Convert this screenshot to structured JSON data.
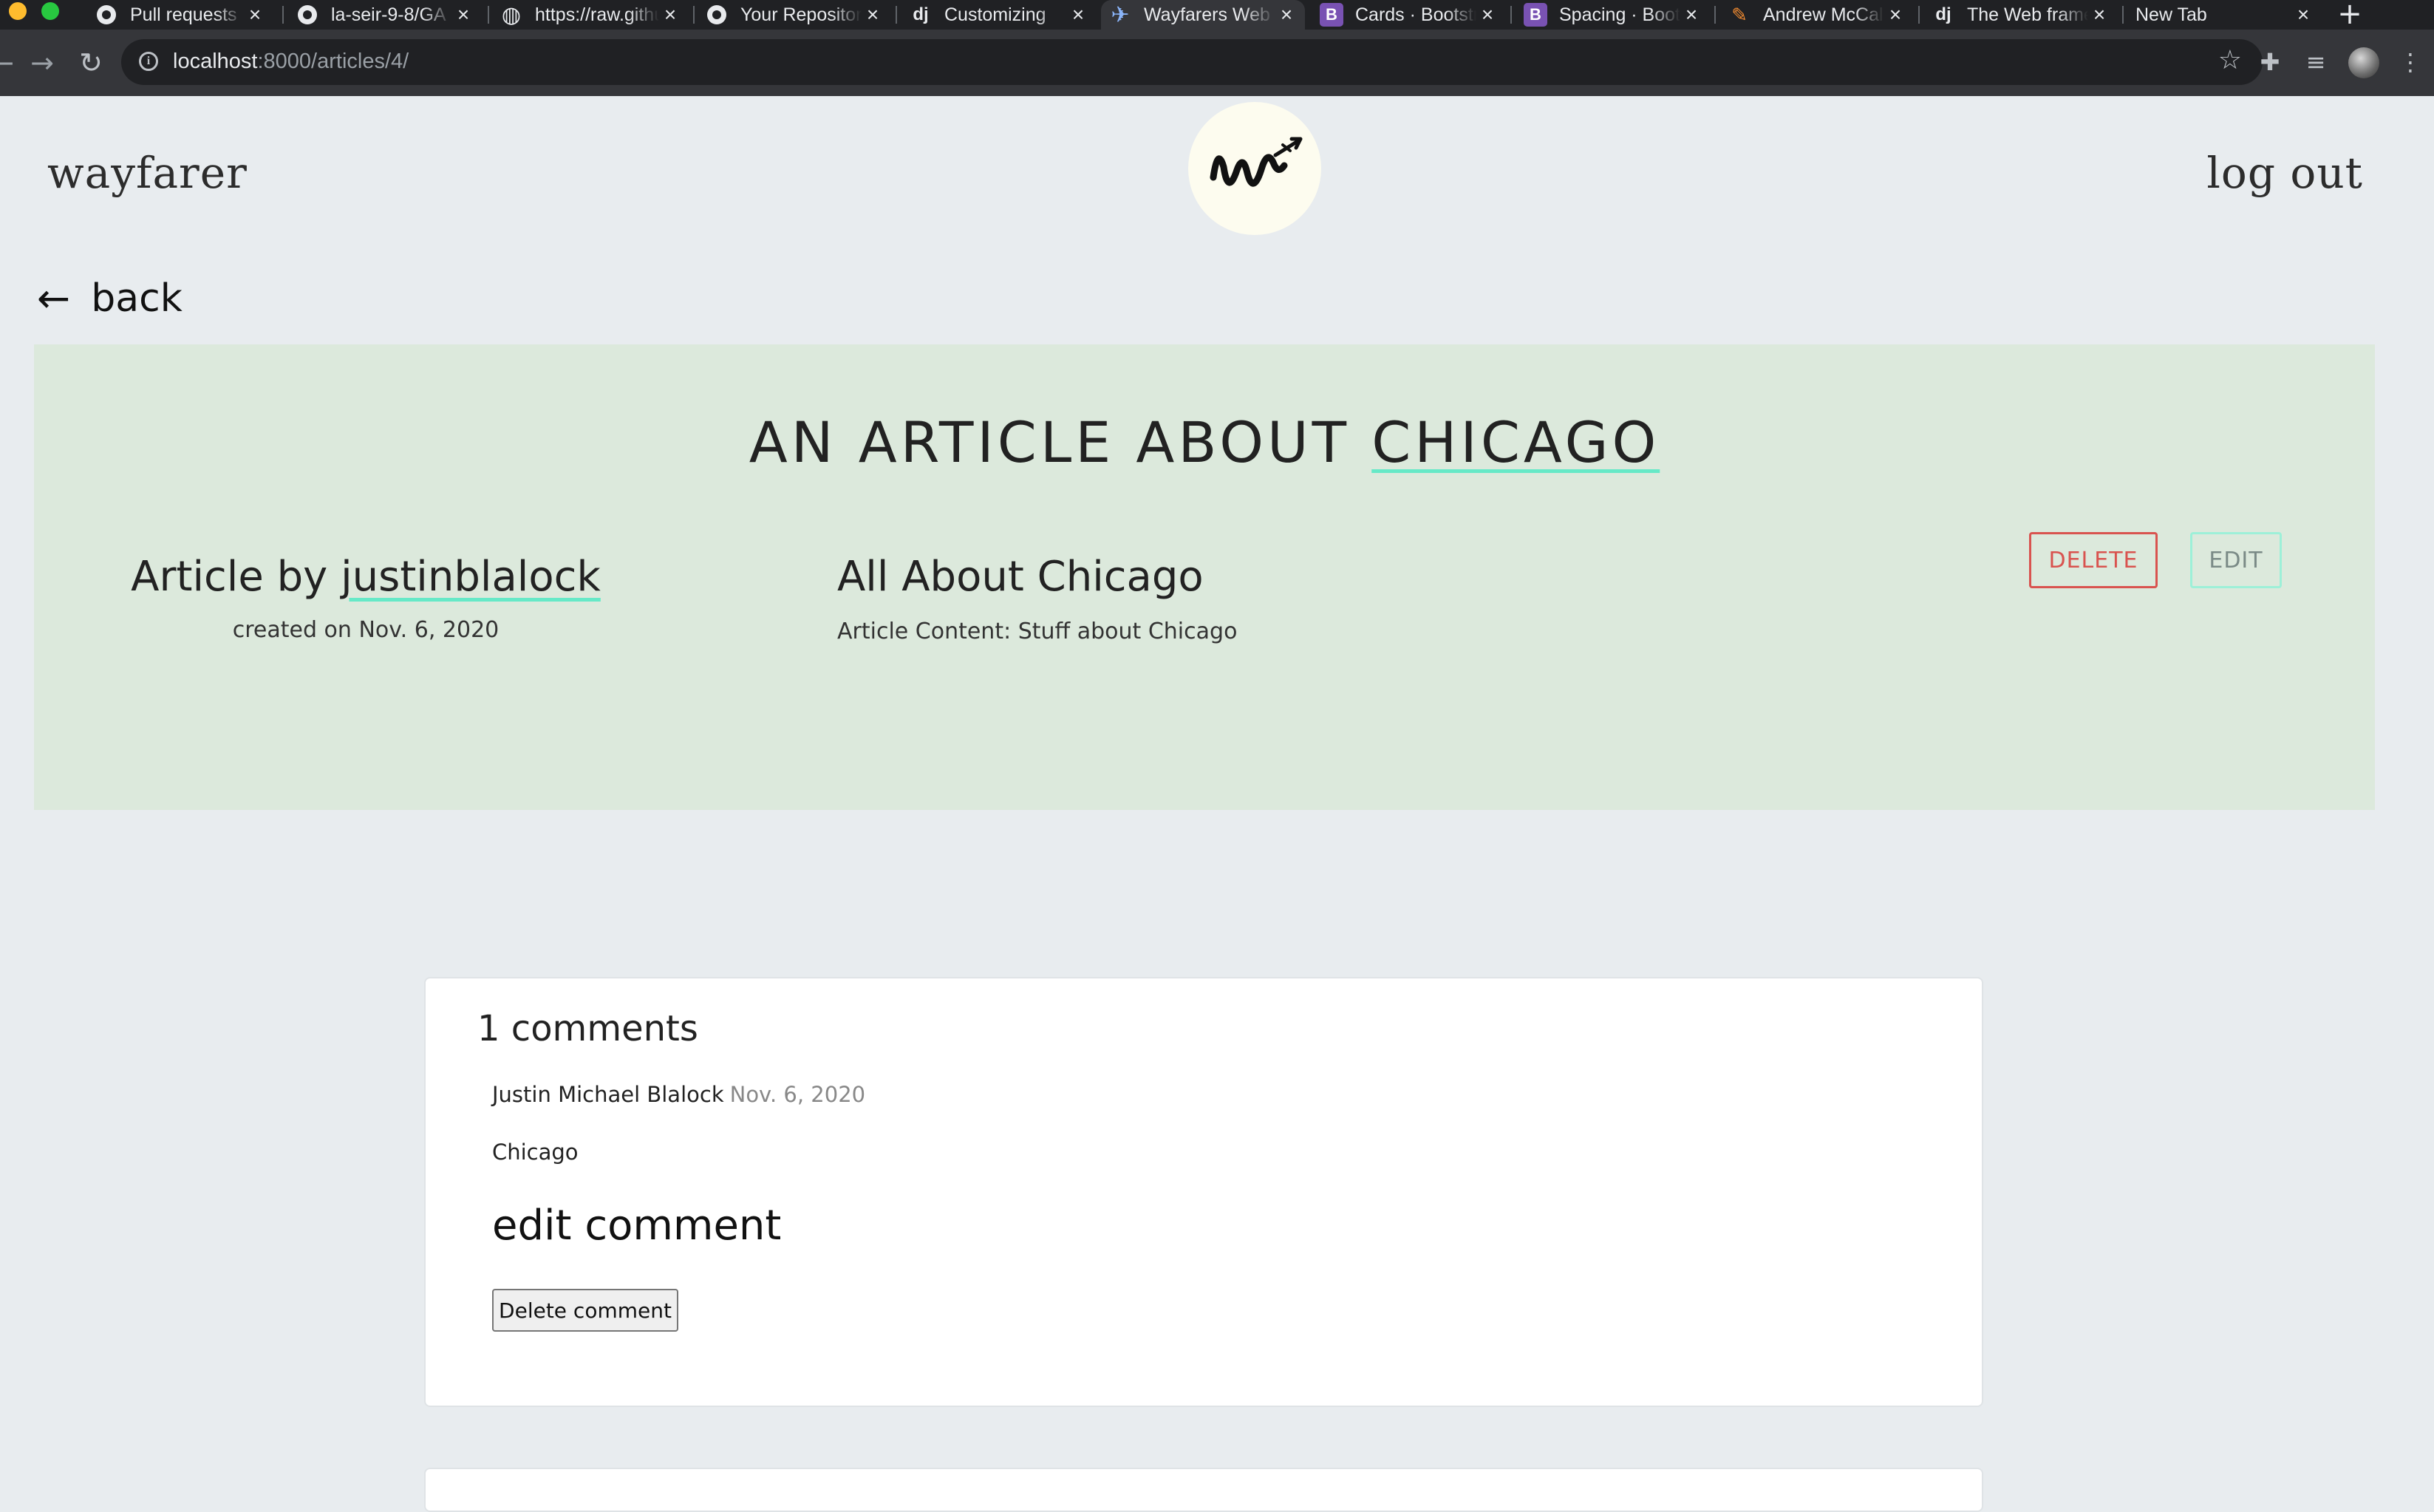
{
  "browser": {
    "tabs": [
      {
        "title": "Pull requests",
        "icon": "github-icon"
      },
      {
        "title": "la-seir-9-8/GA",
        "icon": "github-icon"
      },
      {
        "title": "https://raw.githubusercontent",
        "icon": "globe-icon"
      },
      {
        "title": "Your Repositories",
        "icon": "github-icon"
      },
      {
        "title": "Customizing",
        "icon": "django-icon"
      },
      {
        "title": "Wayfarers Web",
        "icon": "airplane-icon",
        "active": true
      },
      {
        "title": "Cards · Bootstrap",
        "icon": "bootstrap-icon"
      },
      {
        "title": "Spacing · Bootstrap",
        "icon": "bootstrap-icon"
      },
      {
        "title": "Andrew McCall",
        "icon": "pen-icon"
      },
      {
        "title": "The Web framework",
        "icon": "django-icon"
      },
      {
        "title": "New Tab",
        "icon": ""
      }
    ],
    "favicon_text": {
      "django": "dj",
      "bootstrap": "B"
    },
    "url_host": "localhost",
    "url_path": ":8000/articles/4/"
  },
  "navbar": {
    "brand": "wayfarer",
    "logo_letter": "w",
    "logout": "log out"
  },
  "back": {
    "arrow": "←",
    "label": "back"
  },
  "article": {
    "title_prefix": "AN ARTICLE ABOUT ",
    "title_city": "CHICAGO",
    "author_prefix": "Article by ",
    "author": "justinblalock",
    "created": "created on Nov. 6, 2020",
    "heading": "All About Chicago",
    "content": "Article Content: Stuff about Chicago",
    "delete_label": "DELETE",
    "edit_label": "EDIT"
  },
  "comments": {
    "count_label": "1 comments",
    "items": [
      {
        "author": "Justin Michael Blalock",
        "date": "Nov. 6, 2020",
        "text": "Chicago",
        "edit_label": "edit comment",
        "delete_label": "Delete comment"
      }
    ]
  },
  "colors": {
    "page_bg": "#e8ecef",
    "hero_bg": "#dce9dc",
    "accent_underline": "#66e9c7",
    "delete": "#d9534f",
    "edit_border": "#9df0d8"
  }
}
